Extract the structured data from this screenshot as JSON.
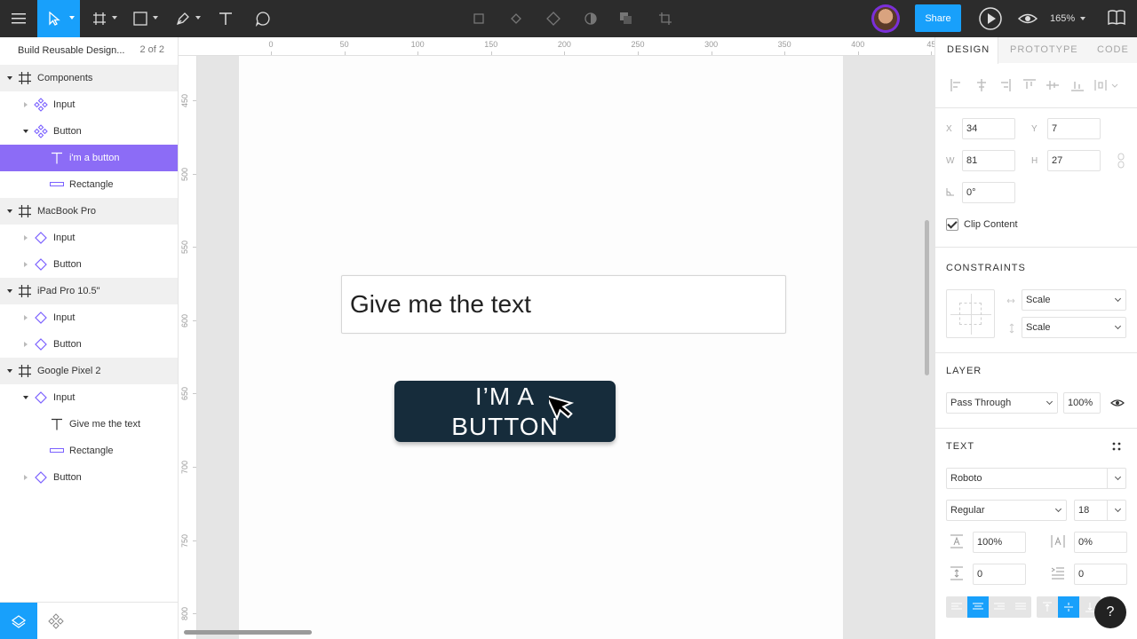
{
  "toolbar": {
    "share_label": "Share",
    "zoom_label": "165%"
  },
  "layers": {
    "document_title": "Build Reusable Design...",
    "page_indicator": "2 of 2",
    "items": [
      {
        "label": "Components",
        "kind": "frame",
        "icon": "frame-icon"
      },
      {
        "label": "Input",
        "kind": "component",
        "icon": "component-icon"
      },
      {
        "label": "Button",
        "kind": "component",
        "icon": "component-icon"
      },
      {
        "label": "i'm a button",
        "kind": "text",
        "icon": "text-icon",
        "selected": true
      },
      {
        "label": "Rectangle",
        "kind": "rectangle",
        "icon": "rectangle-icon"
      },
      {
        "label": "MacBook Pro",
        "kind": "frame",
        "icon": "frame-icon"
      },
      {
        "label": "Input",
        "kind": "instance",
        "icon": "instance-icon"
      },
      {
        "label": "Button",
        "kind": "instance",
        "icon": "instance-icon"
      },
      {
        "label": "iPad Pro 10.5\"",
        "kind": "frame",
        "icon": "frame-icon"
      },
      {
        "label": "Input",
        "kind": "instance",
        "icon": "instance-icon"
      },
      {
        "label": "Button",
        "kind": "instance",
        "icon": "instance-icon"
      },
      {
        "label": "Google Pixel 2",
        "kind": "frame",
        "icon": "frame-icon"
      },
      {
        "label": "Input",
        "kind": "instance",
        "icon": "instance-icon"
      },
      {
        "label": "Give me the text",
        "kind": "text",
        "icon": "text-icon"
      },
      {
        "label": "Rectangle",
        "kind": "rectangle",
        "icon": "rectangle-icon"
      },
      {
        "label": "Button",
        "kind": "instance",
        "icon": "instance-icon"
      }
    ]
  },
  "rulers": {
    "top": [
      "0",
      "50",
      "100",
      "150",
      "200",
      "250",
      "300",
      "350",
      "400",
      "45"
    ],
    "left": [
      "450",
      "500",
      "550",
      "600",
      "650",
      "700",
      "750",
      "800"
    ]
  },
  "canvas": {
    "input_text": "Give me the text",
    "button_text": "I’M A BUTTON"
  },
  "design_panel": {
    "tabs": [
      "DESIGN",
      "PROTOTYPE",
      "CODE"
    ],
    "x_label": "X",
    "x_value": "34",
    "y_label": "Y",
    "y_value": "7",
    "w_label": "W",
    "w_value": "81",
    "h_label": "H",
    "h_value": "27",
    "rotation_value": "0°",
    "clip_content_label": "Clip Content",
    "clip_content_checked": true,
    "constraints_header": "CONSTRAINTS",
    "constraint_h": "Scale",
    "constraint_v": "Scale",
    "layer_header": "LAYER",
    "blend_mode": "Pass Through",
    "opacity": "100%",
    "text_header": "TEXT",
    "font_family": "Roboto",
    "font_weight": "Regular",
    "font_size": "18",
    "line_height": "100%",
    "letter_spacing": "0%",
    "paragraph_spacing": "0",
    "paragraph_indent": "0"
  },
  "help_label": "?",
  "colors": {
    "accent": "#18a0fb",
    "selection": "#8c6cf6",
    "button_fill": "#162c3b",
    "toolbar_bg": "#2c2c2c"
  }
}
